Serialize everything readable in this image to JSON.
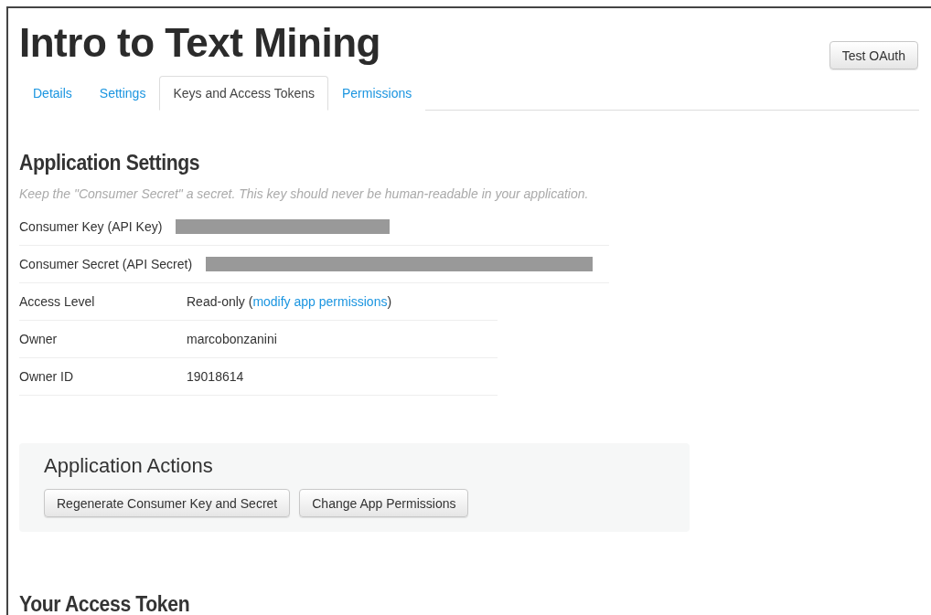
{
  "title": "Intro to Text Mining",
  "header_button": "Test OAuth",
  "tabs": [
    {
      "label": "Details",
      "selected": false
    },
    {
      "label": "Settings",
      "selected": false
    },
    {
      "label": "Keys and Access Tokens",
      "selected": true
    },
    {
      "label": "Permissions",
      "selected": false
    }
  ],
  "settings": {
    "heading": "Application Settings",
    "note": "Keep the \"Consumer Secret\" a secret. This key should never be human-readable in your application.",
    "rows": [
      {
        "label": "Consumer Key (API Key)",
        "kind": "redacted"
      },
      {
        "label": "Consumer Secret (API Secret)",
        "kind": "redacted"
      },
      {
        "label": "Access Level",
        "kind": "link",
        "value": "Read-only (",
        "link": "modify app permissions",
        "suffix": ")"
      },
      {
        "label": "Owner",
        "kind": "text",
        "value": "marcobonzanini"
      },
      {
        "label": "Owner ID",
        "kind": "text",
        "value": "19018614"
      }
    ]
  },
  "actions": {
    "heading": "Application Actions",
    "buttons": [
      "Regenerate Consumer Key and Secret",
      "Change App Permissions"
    ]
  },
  "token_heading": "Your Access Token"
}
